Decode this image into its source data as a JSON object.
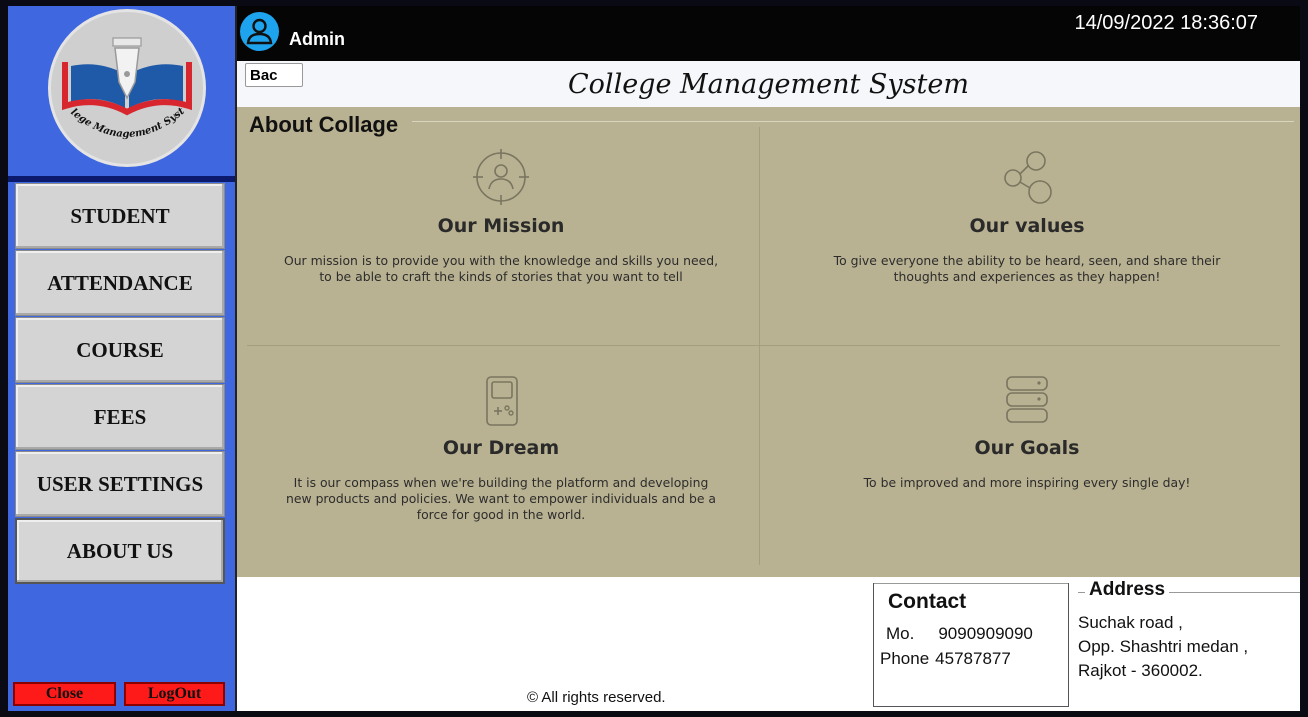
{
  "sidebar": {
    "logo_text": "College Management System",
    "nav": [
      {
        "label": "STUDENT"
      },
      {
        "label": "ATTENDANCE"
      },
      {
        "label": "COURSE"
      },
      {
        "label": "FEES"
      },
      {
        "label": "USER SETTINGS"
      },
      {
        "label": "ABOUT US",
        "active": true
      }
    ],
    "close_label": "Close",
    "logout_label": "LogOut"
  },
  "topbar": {
    "user": "Admin",
    "datetime": "14/09/2022 18:36:07"
  },
  "titlebar": {
    "back_label": "Bac",
    "title": "College Management System"
  },
  "about": {
    "heading": "About Collage",
    "cards": [
      {
        "icon": "target-person-icon",
        "title": "Our Mission",
        "text": "Our mission is to provide you with the knowledge and skills you need, to be able to craft the kinds of stories that you want to tell"
      },
      {
        "icon": "share-icon",
        "title": "Our values",
        "text": "To give everyone the ability to be heard, seen, and share their thoughts and experiences as they happen!"
      },
      {
        "icon": "game-device-icon",
        "title": "Our Dream",
        "text": "It is our compass when we're building the platform and developing new products and policies. We want to empower individuals and be a force for good in the world."
      },
      {
        "icon": "server-stack-icon",
        "title": "Our Goals",
        "text": "To be improved and more inspiring every single day!"
      }
    ]
  },
  "footer": {
    "rights": "© All rights reserved.",
    "contact": {
      "title": "Contact",
      "mobile_label": "Mo.",
      "mobile": "9090909090",
      "phone_label": "Phone",
      "phone": "45787877"
    },
    "address": {
      "title": "Address",
      "line1": "Suchak road ,",
      "line2": "Opp. Shashtri medan ,",
      "line3": "Rajkot - 360002."
    }
  },
  "colors": {
    "sidebar": "#3f67e0",
    "about_panel": "#b9b292",
    "topbar": "#050505",
    "danger": "#ff1a1a",
    "avatar": "#1ea4ef"
  }
}
